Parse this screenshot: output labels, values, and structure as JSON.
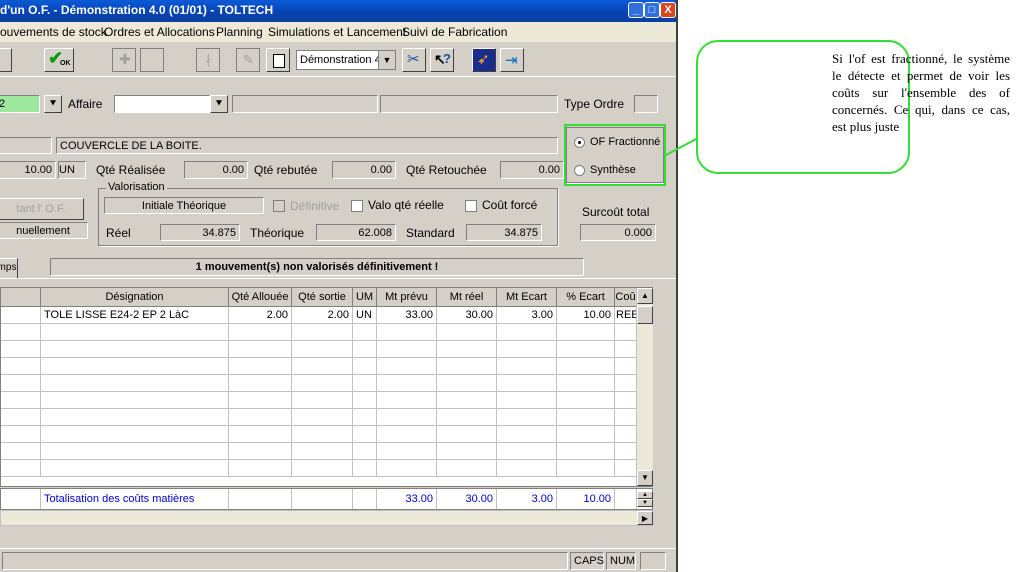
{
  "window": {
    "title": "d'un O.F. - Démonstration 4.0 (01/01) - TOLTECH",
    "controls": {
      "minimize": "_",
      "maximize": "□",
      "close": "X"
    }
  },
  "menu": [
    "ouvements de stock",
    "Ordres et Allocations",
    "Planning",
    "Simulations et Lancement",
    "Suivi de Fabrication"
  ],
  "toolbar": {
    "ok_label": "OK",
    "company_select": "Démonstration 4",
    "help_label": "?"
  },
  "header": {
    "code_value": "2",
    "affaire_label": "Affaire",
    "type_ordre_label": "Type Ordre",
    "designation": "COUVERCLE DE LA BOITE.",
    "qty_value": "10.00",
    "qty_unit": "UN",
    "qte_realisee_label": "Qté Réalisée",
    "qte_realisee_value": "0.00",
    "qte_rebutee_label": "Qté rebutée",
    "qte_rebutee_value": "0.00",
    "qte_retouchee_label": "Qté Retouchée",
    "qte_retouchee_value": "0.00"
  },
  "of_options": {
    "fractionne_label": "OF Fractionné",
    "synthese_label": "Synthèse",
    "selected": "fractionne"
  },
  "valorisation": {
    "left_disabled_label": "tant l' O.F.",
    "left_mode": "nuellement",
    "group_label": "Valorisation",
    "mode_value": "Initiale Théorique",
    "definitive_label": "Définitive",
    "valo_qte_label": "Valo qté réelle",
    "cout_force_label": "Coût forcé",
    "reel_label": "Réel",
    "reel_value": "34.875",
    "theorique_label": "Théorique",
    "theorique_value": "62.008",
    "standard_label": "Standard",
    "standard_value": "34.875",
    "surcout_label": "Surcoût total",
    "surcout_value": "0.000"
  },
  "tab_label": "mps",
  "message": "1 mouvement(s) non valorisés définitivement !",
  "grid": {
    "headers": [
      "",
      "Désignation",
      "Qté Allouée",
      "Qté sortie",
      "UM",
      "Mt prévu",
      "Mt réel",
      "Mt Ecart",
      "% Ecart",
      "Coû"
    ],
    "rows": [
      [
        "",
        "TOLE LISSE E24-2 EP 2 LàC",
        "2.00",
        "2.00",
        "UN",
        "33.00",
        "30.00",
        "3.00",
        "10.00",
        "REE"
      ]
    ],
    "total": {
      "label": "Totalisation des coûts matières",
      "mt_prevu": "33.00",
      "mt_reel": "30.00",
      "mt_ecart": "3.00",
      "pct_ecart": "10.00"
    }
  },
  "status": {
    "caps": "CAPS",
    "num": "NUM"
  },
  "annotation": "Si l'of est fractionné, le système le détecte et permet de voir les coûts sur l'ensemble des of concernés. Ce qui, dans ce cas, est plus juste"
}
